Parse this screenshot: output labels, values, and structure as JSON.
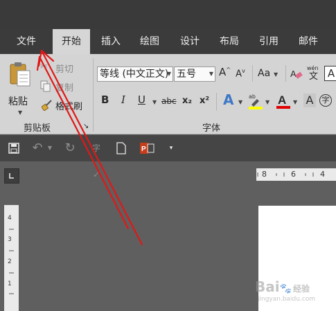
{
  "tabs": [
    {
      "label": "文件",
      "active": false
    },
    {
      "label": "开始",
      "active": true
    },
    {
      "label": "插入",
      "active": false
    },
    {
      "label": "绘图",
      "active": false
    },
    {
      "label": "设计",
      "active": false
    },
    {
      "label": "布局",
      "active": false
    },
    {
      "label": "引用",
      "active": false
    },
    {
      "label": "邮件",
      "active": false
    }
  ],
  "clipboard": {
    "paste_label": "粘贴",
    "cut_label": "剪切",
    "copy_label": "复制",
    "format_painter_label": "格式刷",
    "group_label": "剪贴板"
  },
  "font": {
    "font_name": "等线 (中文正文)",
    "font_size": "五号",
    "case_label": "Aa",
    "phonetic_label": "wén",
    "bold": "B",
    "italic": "I",
    "underline": "U",
    "strikethrough": "abc",
    "subscript": "x₂",
    "superscript": "x²",
    "group_label": "字体",
    "highlight_color": "#ffff00",
    "font_color": "#e00000"
  },
  "ruler": {
    "horizontal_marks": [
      "8",
      "6",
      "4"
    ],
    "vertical_marks": [
      "4",
      "3",
      "2",
      "1"
    ]
  },
  "annotation": {
    "arrow_color": "#e01818"
  },
  "watermark": {
    "brand": "Bai",
    "brand_suffix": "经验",
    "url": "jingyan.baidu.com"
  }
}
